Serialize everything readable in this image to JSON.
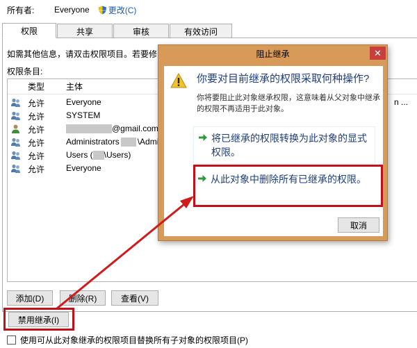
{
  "owner": {
    "label": "所有者:",
    "value": "Everyone",
    "change": "更改(C)"
  },
  "tabs": [
    {
      "label": "权限",
      "active": true
    },
    {
      "label": "共享",
      "active": false
    },
    {
      "label": "审核",
      "active": false
    },
    {
      "label": "有效访问",
      "active": false
    }
  ],
  "info_text": "如需其他信息，请双击权限项目。若要修",
  "entries_label": "权限条目:",
  "list": {
    "headers": {
      "type": "类型",
      "principal": "主体"
    },
    "rows": [
      {
        "icon": "group-icon",
        "type": "允许",
        "principal": "Everyone",
        "trail": "n ..."
      },
      {
        "icon": "group-icon",
        "type": "允许",
        "principal": "SYSTEM"
      },
      {
        "icon": "user-icon",
        "type": "允许",
        "principal_suffix": "@gmail.com"
      },
      {
        "icon": "group-icon",
        "type": "允许",
        "principal_prefix": "Administrators",
        "principal_suffix": "\\Admi"
      },
      {
        "icon": "group-icon",
        "type": "允许",
        "principal_prefix": "Users (",
        "principal_suffix": "\\Users)"
      },
      {
        "icon": "group-icon",
        "type": "允许",
        "principal": "Everyone"
      }
    ]
  },
  "buttons": {
    "add": "添加(D)",
    "remove": "删除(R)",
    "view": "查看(V)",
    "disable_inheritance": "禁用继承(I)"
  },
  "checkbox_label": "使用可从此对象继承的权限项目替换所有子对象的权限项目(P)",
  "dialog": {
    "title": "阻止继承",
    "close": "✕",
    "heading": "你要对目前继承的权限采取何种操作?",
    "description": "你将要阻止此对象继承权限，这意味着从父对象中继承的权限不再适用于此对象。",
    "option_convert": "将已继承的权限转换为此对象的显式权限。",
    "option_remove": "从此对象中删除所有已继承的权限。",
    "cancel": "取消"
  },
  "colors": {
    "highlight": "#c0111b",
    "link": "#1f3f7a",
    "dialog_frame": "#d89a58"
  }
}
